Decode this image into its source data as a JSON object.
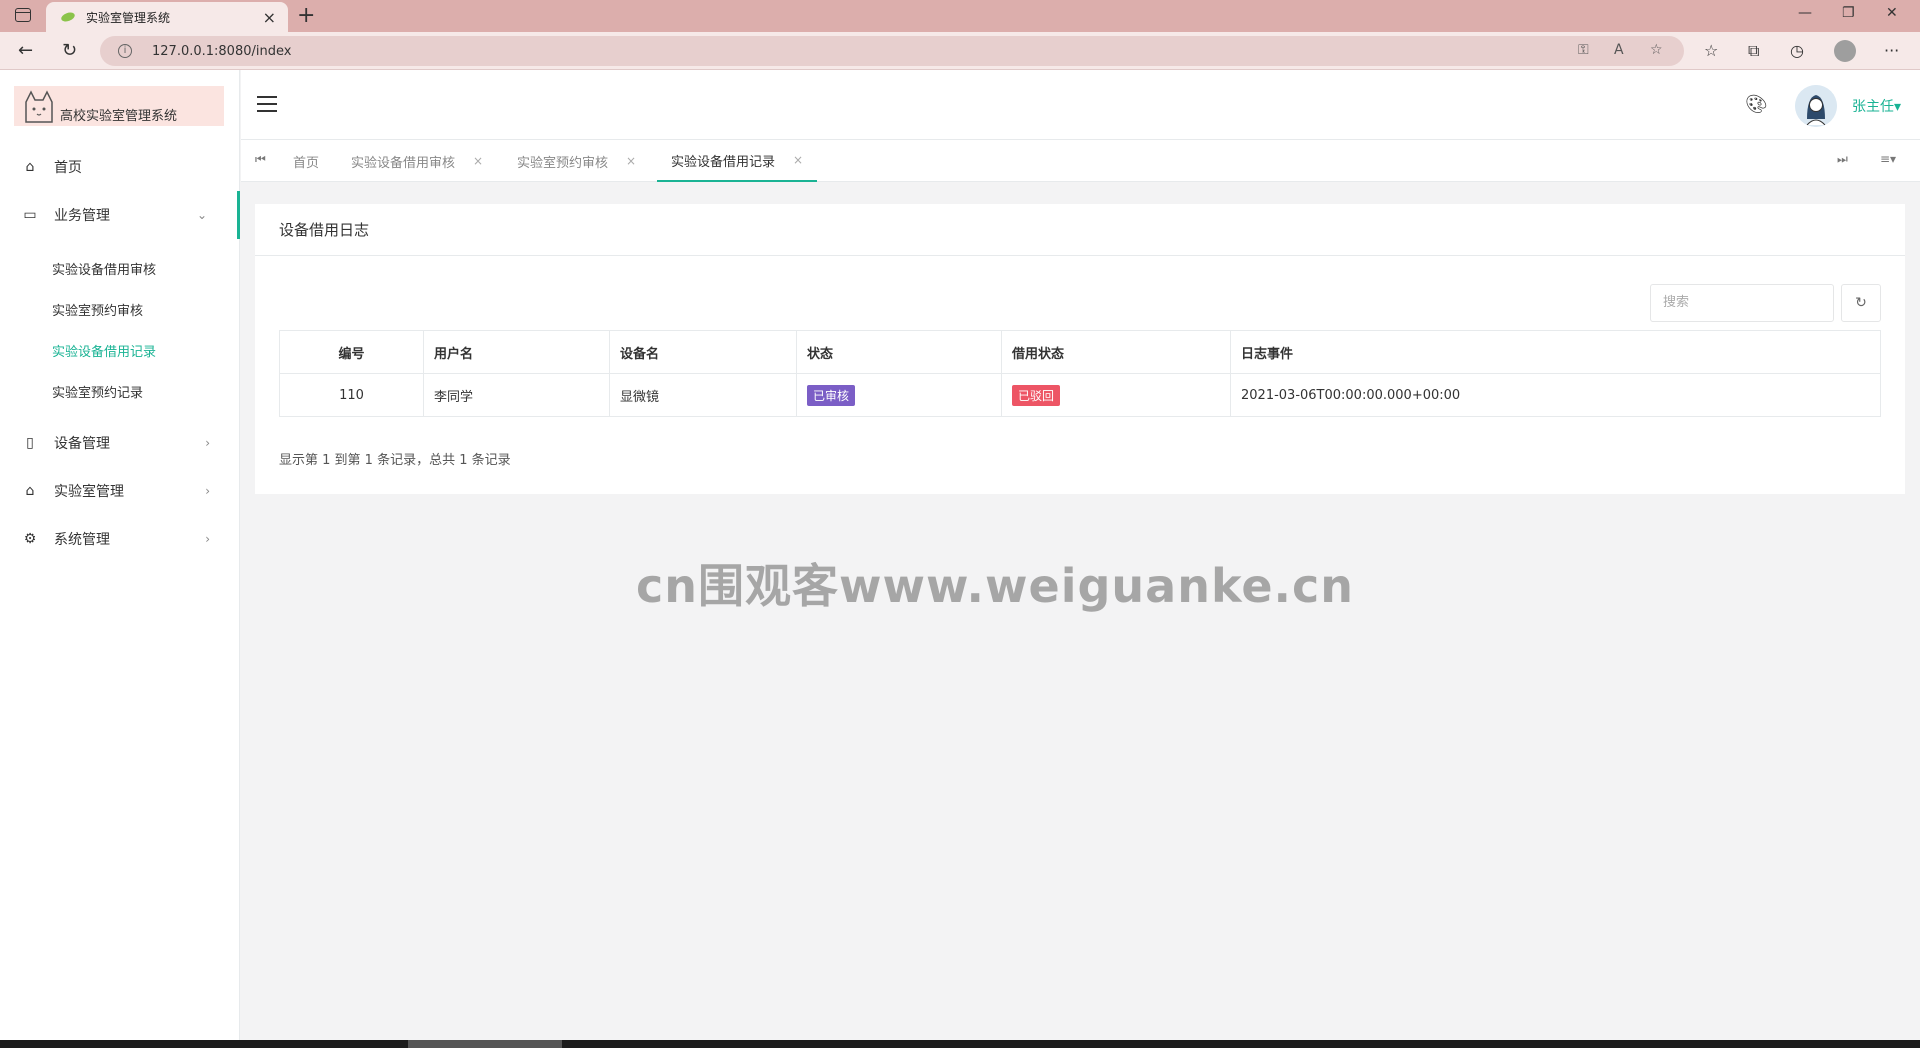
{
  "browser": {
    "tab_title": "实验室管理系统",
    "url": "127.0.0.1:8080/index"
  },
  "sidebar": {
    "logo_text": "高校实验室管理系统",
    "items": [
      {
        "label": "首页",
        "icon": "home-icon"
      },
      {
        "label": "业务管理",
        "icon": "laptop-icon"
      },
      {
        "label": "设备管理",
        "icon": "device-icon"
      },
      {
        "label": "实验室管理",
        "icon": "lab-icon"
      },
      {
        "label": "系统管理",
        "icon": "gear-icon"
      }
    ],
    "sub_items": [
      "实验设备借用审核",
      "实验室预约审核",
      "实验设备借用记录",
      "实验室预约记录"
    ]
  },
  "header": {
    "username": "张主任"
  },
  "page_tabs": [
    {
      "label": "首页"
    },
    {
      "label": "实验设备借用审核"
    },
    {
      "label": "实验室预约审核"
    },
    {
      "label": "实验设备借用记录"
    }
  ],
  "main": {
    "title": "设备借用日志",
    "search_placeholder": "搜索",
    "table": {
      "headers": [
        "编号",
        "用户名",
        "设备名",
        "状态",
        "借用状态",
        "日志事件"
      ],
      "rows": [
        [
          "110",
          "李同学",
          "显微镜",
          "已审核",
          "已驳回",
          "2021-03-06T00:00:00.000+00:00"
        ]
      ]
    },
    "pagination_info": "显示第 1 到第 1 条记录，总共 1 条记录"
  },
  "watermark": "cn围观客www.weiguanke.cn",
  "colors": {
    "accent": "#1ab394",
    "badge_reviewed": "#7b5ec6",
    "badge_rejected": "#ed5565",
    "browser_frame": "#dcaeac"
  }
}
